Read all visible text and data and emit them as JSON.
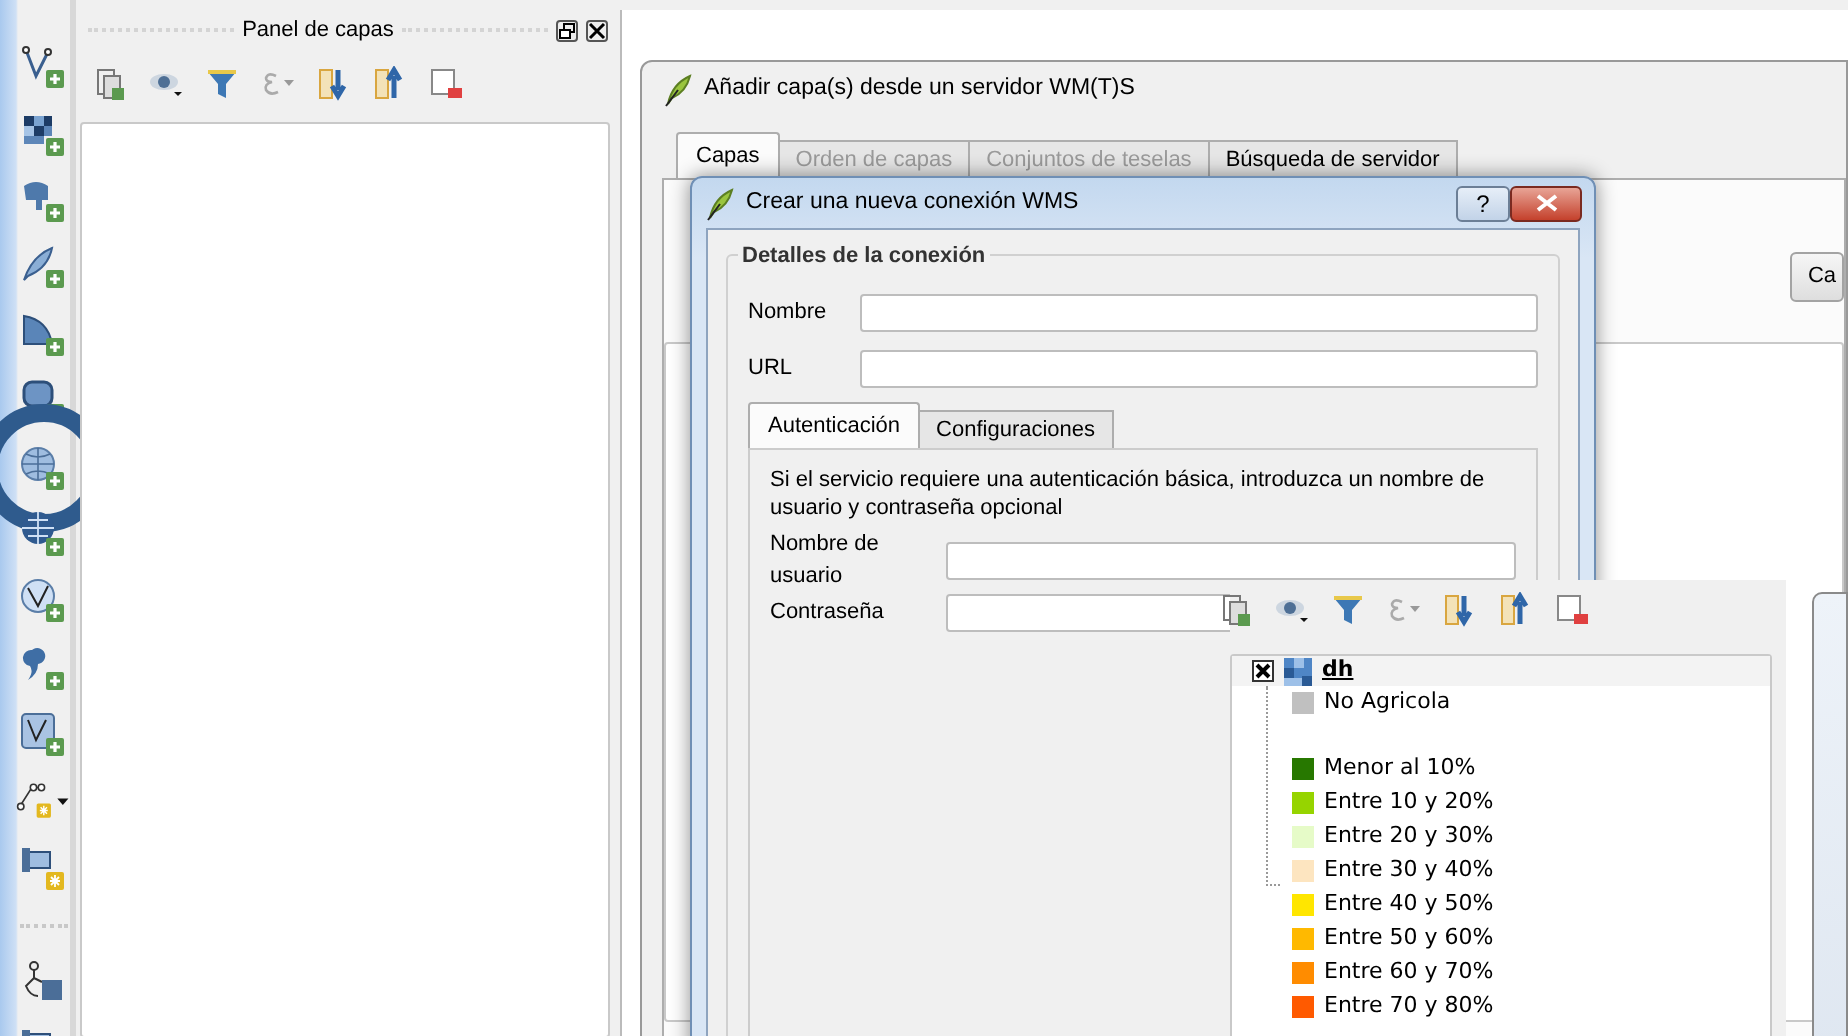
{
  "left_toolbar": {
    "tools": [
      {
        "kind": "vector",
        "highlighted": false
      },
      {
        "kind": "raster",
        "highlighted": false
      },
      {
        "kind": "database",
        "highlighted": false
      },
      {
        "kind": "feather",
        "highlighted": false
      },
      {
        "kind": "sail",
        "highlighted": false
      },
      {
        "kind": "rounded",
        "highlighted": false
      },
      {
        "kind": "globe",
        "highlighted": true
      },
      {
        "kind": "globe-grid",
        "highlighted": false
      },
      {
        "kind": "globe-vector",
        "highlighted": false
      },
      {
        "kind": "comma",
        "highlighted": false
      },
      {
        "kind": "virtual",
        "highlighted": false
      },
      {
        "kind": "line-new",
        "highlighted": false
      },
      {
        "kind": "pipe-new",
        "highlighted": false
      },
      {
        "kind": "separator"
      },
      {
        "kind": "person",
        "highlighted": false
      },
      {
        "kind": "pipe",
        "highlighted": false
      }
    ]
  },
  "layers_panel": {
    "title": "Panel de capas"
  },
  "wms_dialog": {
    "title": "Añadir capa(s) desde un servidor WM(T)S",
    "tabs": [
      {
        "label": "Capas",
        "selected": true,
        "disabled": false
      },
      {
        "label": "Orden de capas",
        "selected": false,
        "disabled": true
      },
      {
        "label": "Conjuntos de teselas",
        "selected": false,
        "disabled": true
      },
      {
        "label": "Búsqueda de servidor",
        "selected": false,
        "disabled": false
      }
    ],
    "button": "Ca"
  },
  "connection_dialog": {
    "title": "Crear una nueva conexión WMS",
    "help_button": "?",
    "group_title": "Detalles de la conexión",
    "fields": [
      {
        "label": "Nombre"
      },
      {
        "label": "URL"
      }
    ],
    "tabs": [
      {
        "label": "Autenticación",
        "selected": true
      },
      {
        "label": "Configuraciones",
        "selected": false
      }
    ],
    "auth_note": "Si el servicio requiere una autenticación básica, introduzca un nombre de usuario y contraseña opcional",
    "auth_fields": [
      {
        "label": "Nombre de usuario"
      },
      {
        "label": "Contraseña"
      }
    ]
  },
  "layer_tree": {
    "layer": {
      "name": "dh",
      "checked": true,
      "expanded": true,
      "children": [
        {
          "label": "No Agricola",
          "color": "#c0c0c0",
          "gap_before": false
        },
        {
          "label": "Menor al 10%",
          "color": "#277800",
          "gap_before": true
        },
        {
          "label": "Entre 10 y 20%",
          "color": "#96d400",
          "gap_before": false
        },
        {
          "label": "Entre 20 y 30%",
          "color": "#e6fbc8",
          "gap_before": false
        },
        {
          "label": "Entre 30 y 40%",
          "color": "#fde5c0",
          "gap_before": false
        },
        {
          "label": "Entre 40 y 50%",
          "color": "#ffe600",
          "gap_before": false
        },
        {
          "label": "Entre 50 y 60%",
          "color": "#ffb900",
          "gap_before": false
        },
        {
          "label": "Entre 60 y 70%",
          "color": "#ff8c00",
          "gap_before": false
        },
        {
          "label": "Entre 70 y 80%",
          "color": "#ff5a00",
          "gap_before": false
        }
      ]
    }
  }
}
